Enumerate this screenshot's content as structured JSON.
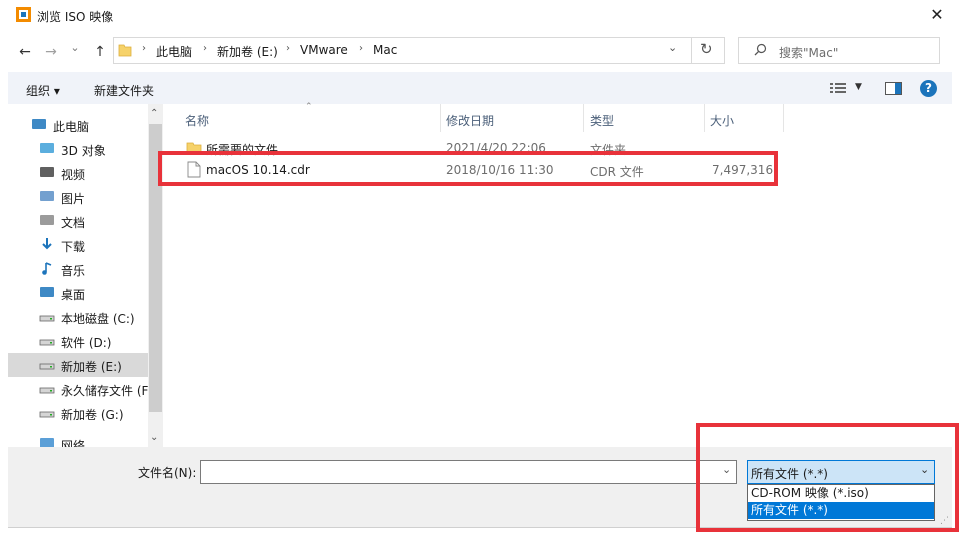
{
  "window": {
    "title": "浏览 ISO 映像",
    "close": "✕"
  },
  "nav": {
    "back": "←",
    "forward": "→",
    "dropdown": "⌄",
    "up": "↑",
    "breadcrumbs": [
      "此电脑",
      "新加卷 (E:)",
      "VMware",
      "Mac"
    ],
    "refresh": "↻",
    "search_placeholder": "搜索\"Mac\""
  },
  "toolbar": {
    "organize": "组织 ▾",
    "new_folder": "新建文件夹",
    "help": "?"
  },
  "sidebar": {
    "items": [
      {
        "label": "此电脑",
        "icon": "computer-icon"
      },
      {
        "label": "3D 对象",
        "icon": "cube-icon"
      },
      {
        "label": "视频",
        "icon": "video-icon"
      },
      {
        "label": "图片",
        "icon": "picture-icon"
      },
      {
        "label": "文档",
        "icon": "document-icon"
      },
      {
        "label": "下载",
        "icon": "download-icon"
      },
      {
        "label": "音乐",
        "icon": "music-icon"
      },
      {
        "label": "桌面",
        "icon": "desktop-icon"
      },
      {
        "label": "本地磁盘 (C:)",
        "icon": "drive-icon"
      },
      {
        "label": "软件 (D:)",
        "icon": "drive-icon"
      },
      {
        "label": "新加卷 (E:)",
        "icon": "drive-icon",
        "selected": true
      },
      {
        "label": "永久储存文件 (F",
        "icon": "drive-icon"
      },
      {
        "label": "新加卷 (G:)",
        "icon": "drive-icon"
      },
      {
        "label": "网络",
        "icon": "network-icon"
      }
    ]
  },
  "filelist": {
    "columns": [
      "名称",
      "修改日期",
      "类型",
      "大小"
    ],
    "rows": [
      {
        "name": "所需要的文件",
        "date": "2021/4/20 22:06",
        "type": "文件夹",
        "size": ""
      },
      {
        "name": "macOS 10.14.cdr",
        "date": "2018/10/16 11:30",
        "type": "CDR 文件",
        "size": "7,497,316,"
      }
    ]
  },
  "bottom": {
    "filename_label": "文件名(N):",
    "filename_value": "",
    "filter_selected": "所有文件 (*.*)",
    "filter_options": [
      "CD-ROM 映像 (*.iso)",
      "所有文件 (*.*)"
    ]
  },
  "colors": {
    "highlight": "#e8323a",
    "accent": "#0078d7",
    "selection": "#cce4f7"
  }
}
